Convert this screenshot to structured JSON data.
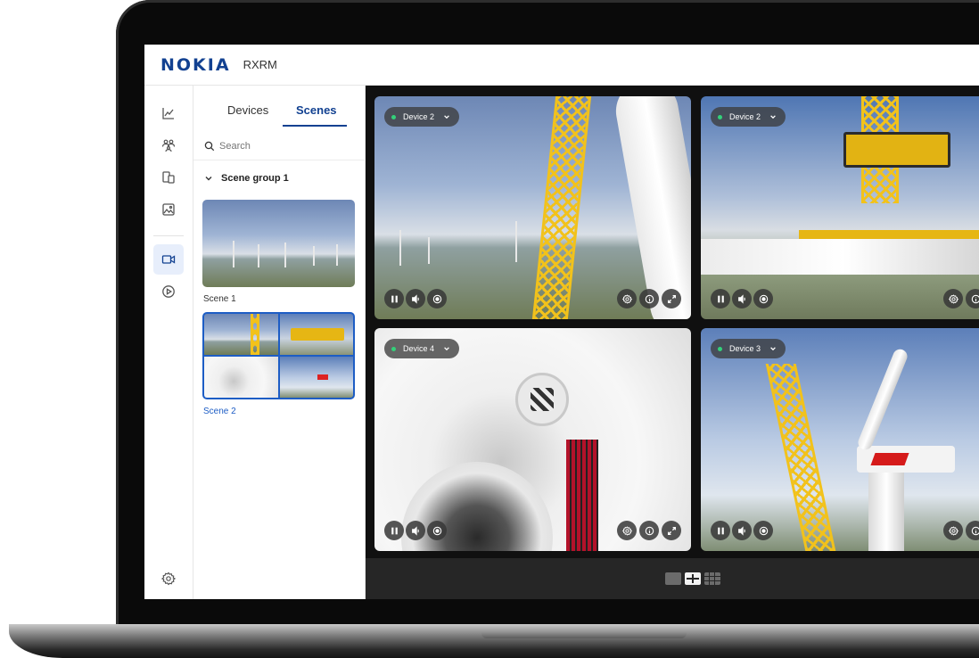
{
  "app": {
    "logo": "NOKIA",
    "name": "RXRM"
  },
  "rail": {
    "items": [
      {
        "icon": "analytics-icon"
      },
      {
        "icon": "users-icon"
      },
      {
        "icon": "devices-icon"
      },
      {
        "icon": "media-icon"
      },
      {
        "icon": "video-icon",
        "active": true
      },
      {
        "icon": "play-icon"
      }
    ],
    "settings_icon": "gear-icon"
  },
  "panel": {
    "tabs": [
      {
        "label": "Devices",
        "active": false
      },
      {
        "label": "Scenes",
        "active": true
      }
    ],
    "search_placeholder": "Search",
    "group_label": "Scene group 1",
    "scenes": [
      {
        "label": "Scene 1",
        "selected": false
      },
      {
        "label": "Scene 2",
        "selected": true
      }
    ]
  },
  "tiles": [
    {
      "device": "Device 2"
    },
    {
      "device": "Device 2"
    },
    {
      "device": "Device 4"
    },
    {
      "device": "Device 3"
    }
  ],
  "layout_options": [
    "single",
    "grid-2x2",
    "grid-3x3"
  ],
  "selected_layout": "grid-2x2",
  "colors": {
    "brand": "#124191",
    "accent": "#1d5dc5",
    "status_online": "#33d17a"
  }
}
